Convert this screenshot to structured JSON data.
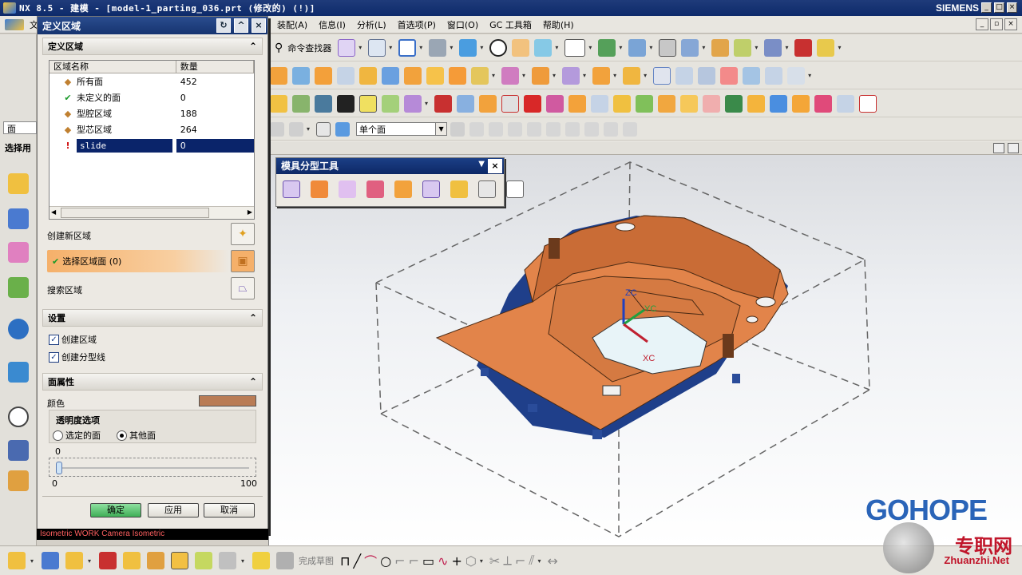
{
  "window": {
    "title": "NX 8.5 - 建模 - [model-1_parting_036.prt (修改的)     (!)]",
    "brand": "SIEMENS",
    "controls": [
      "_",
      "□",
      "×"
    ]
  },
  "menu": {
    "items": [
      "文",
      "装配(A)",
      "信息(I)",
      "分析(L)",
      "首选项(P)",
      "窗口(O)",
      "GC 工具箱",
      "帮助(H)"
    ]
  },
  "toolbar": {
    "command_finder": "命令查找器",
    "selection_filter": "单个面"
  },
  "left_panel": {
    "filter_field": "面",
    "selection_label": "选择用"
  },
  "dialog": {
    "title": "定义区域",
    "section_define": "定义区域",
    "columns": [
      "区域名称",
      "数量"
    ],
    "rows": [
      {
        "name": "所有面",
        "count": "452",
        "icon": "faces-icon"
      },
      {
        "name": "未定义的面",
        "count": "0",
        "icon": "check-icon"
      },
      {
        "name": "型腔区域",
        "count": "188",
        "icon": "cavity-region-icon"
      },
      {
        "name": "型芯区域",
        "count": "264",
        "icon": "core-region-icon"
      },
      {
        "name": "slide",
        "count": "0",
        "icon": "warning-icon"
      }
    ],
    "create_region": "创建新区域",
    "select_region_faces": "选择区域面 (0)",
    "search_region": "搜索区域",
    "section_settings": "设置",
    "settings": {
      "create_regions": "创建区域",
      "create_parting_lines": "创建分型线",
      "create_regions_checked": true,
      "create_parting_lines_checked": true
    },
    "section_face_props": "面属性",
    "color_label": "颜色",
    "face_color": "#b97c55",
    "transparency_title": "透明度选项",
    "radio_selected": "选定的面",
    "radio_other": "其他面",
    "radio_choice": "其他面",
    "slider_value": "0",
    "slider_min": "0",
    "slider_max": "100",
    "buttons": {
      "ok": "确定",
      "apply": "应用",
      "cancel": "取消"
    }
  },
  "float_toolbar": {
    "title": "模具分型工具"
  },
  "status": {
    "view_text": "Isometric WORK Camera Isometric"
  },
  "bottom_toolbar": {
    "finish_sketch": "完成草图"
  },
  "viewport": {
    "axis_zc": "ZC",
    "axis_yc": "YC",
    "axis_xc": "XC",
    "part_color": "#e2844a"
  },
  "watermark": {
    "logo": "GOHOPE",
    "site_cn": "专职网",
    "site_url": "Zhuanzhi.Net"
  }
}
